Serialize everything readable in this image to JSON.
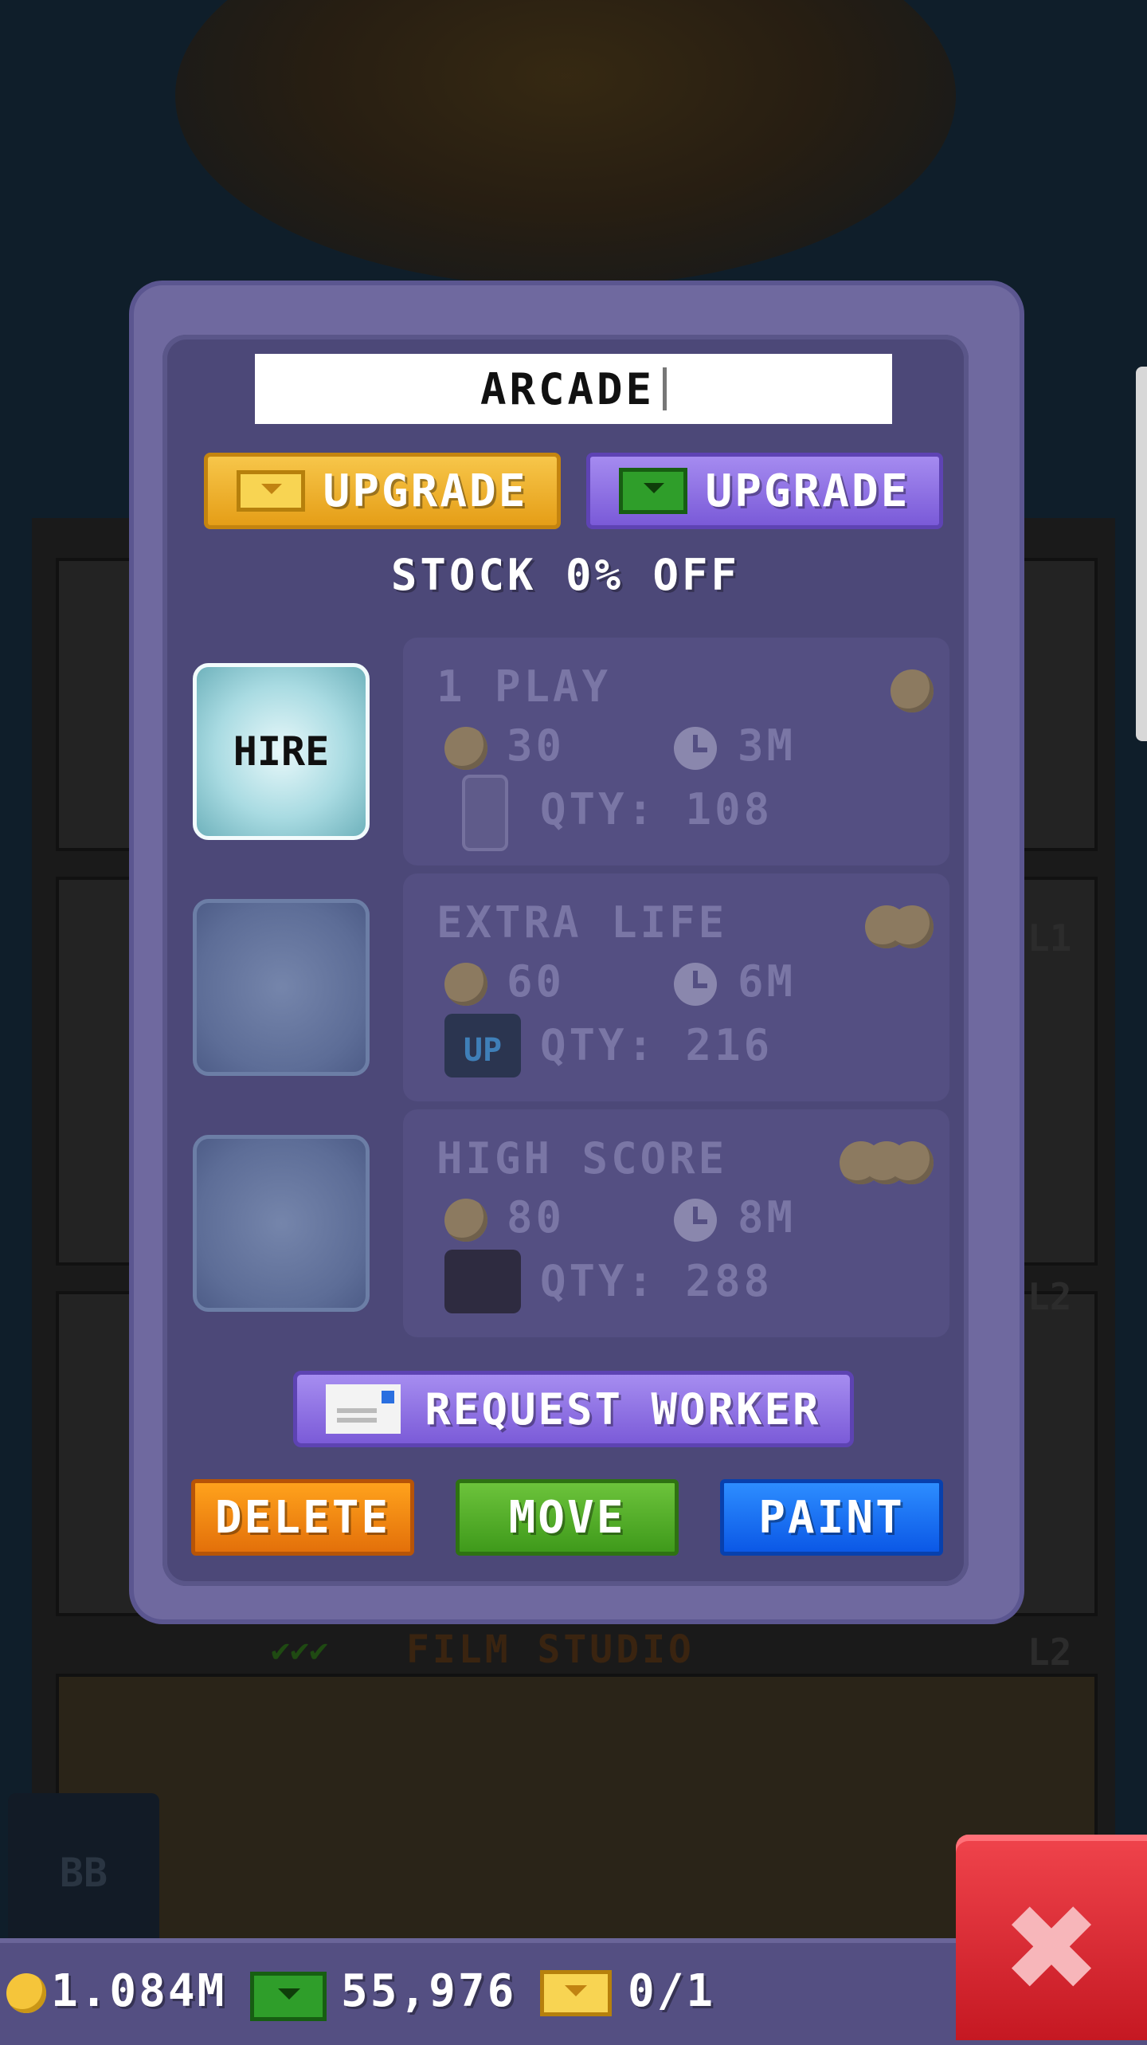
{
  "dialog": {
    "name_field_value": "ARCADE",
    "upgrade_tickets_label": "UPGRADE",
    "upgrade_bux_label": "UPGRADE",
    "stock_discount": "STOCK 0% OFF",
    "hire_label": "HIRE",
    "items": [
      {
        "title": "1 PLAY",
        "price": "30",
        "time": "3M",
        "qty": "QTY: 108",
        "icon": "arcade-cabinet-icon",
        "tier_coins": 1
      },
      {
        "title": "EXTRA LIFE",
        "price": "60",
        "time": "6M",
        "qty": "QTY: 216",
        "icon": "one-up-icon",
        "tier_coins": 2
      },
      {
        "title": "HIGH SCORE",
        "price": "80",
        "time": "8M",
        "qty": "QTY: 288",
        "icon": "scoreboard-icon",
        "tier_coins": 3
      }
    ],
    "request_worker_label": "REQUEST WORKER",
    "delete_label": "DELETE",
    "move_label": "MOVE",
    "paint_label": "PAINT"
  },
  "background": {
    "floor_name": "FILM STUDIO",
    "floor_levels": [
      "L1",
      "L2",
      "L2"
    ],
    "bb_label": "BB"
  },
  "status_bar": {
    "coins": "1.084M",
    "bux": "55,976",
    "tickets": "0/1"
  },
  "colors": {
    "dialog_bg": "#4c4878",
    "gold_button": "#e59e17",
    "purple_button": "#7a5ad8",
    "delete_orange": "#e3700a",
    "move_green": "#3f9a1b",
    "paint_blue": "#0b58e6",
    "close_red": "#c51822"
  }
}
